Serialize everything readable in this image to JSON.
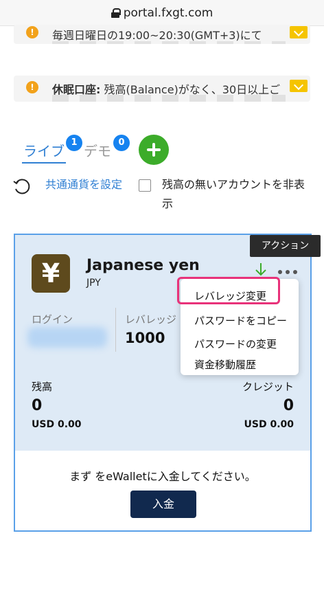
{
  "browser": {
    "url": "portal.fxgt.com"
  },
  "notices": [
    {
      "text": "毎週日曜日の19:00~20:30(GMT+3)にて"
    },
    {
      "label": "休眠口座:",
      "text": "残高(Balance)がなく、30日以上ご"
    }
  ],
  "tabs": {
    "live_label": "ライブ",
    "live_count": "1",
    "demo_label": "デモ",
    "demo_count": "0"
  },
  "controls": {
    "currency_link": "共通通貨を設定",
    "hide_label": "残高の無いアカウントを非表示"
  },
  "account": {
    "name": "Japanese yen",
    "code": "JPY",
    "login_label": "ログイン",
    "leverage_label": "レバレッジ",
    "leverage_value": "1000",
    "balance_label": "残高",
    "balance_value": "0",
    "balance_sub": "USD 0.00",
    "credit_label": "クレジット",
    "credit_value": "0",
    "credit_sub": "USD 0.00",
    "message": "まず をeWalletに入金してください。",
    "deposit_label": "入金"
  },
  "actions": {
    "tooltip": "アクション",
    "menu": [
      "レバレッジ変更",
      "パスワードをコピー",
      "パスワードの変更",
      "資金移動履歴"
    ]
  },
  "colors": {
    "accent": "#2f7fd3",
    "badge": "#1683f0",
    "add_button": "#3cac2a",
    "deposit_button": "#11294e",
    "highlight": "#e8327a",
    "card_bg": "#deeaf6"
  }
}
